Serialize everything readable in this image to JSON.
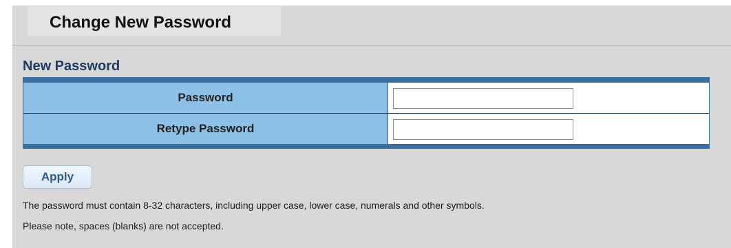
{
  "header": {
    "title": "Change New Password"
  },
  "section": {
    "title": "New Password"
  },
  "form": {
    "rows": [
      {
        "label": "Password",
        "value": "",
        "placeholder": ""
      },
      {
        "label": "Retype Password",
        "value": "",
        "placeholder": ""
      }
    ]
  },
  "actions": {
    "apply_label": "Apply"
  },
  "notes": [
    "The password must contain 8-32 characters, including upper case, lower case, numerals and other symbols.",
    "Please note, spaces (blanks) are not accepted."
  ],
  "colors": {
    "background": "#d8d8d8",
    "table_border": "#3b6f9f",
    "label_cell": "#8dc0e6",
    "button_text": "#2e5a88"
  }
}
